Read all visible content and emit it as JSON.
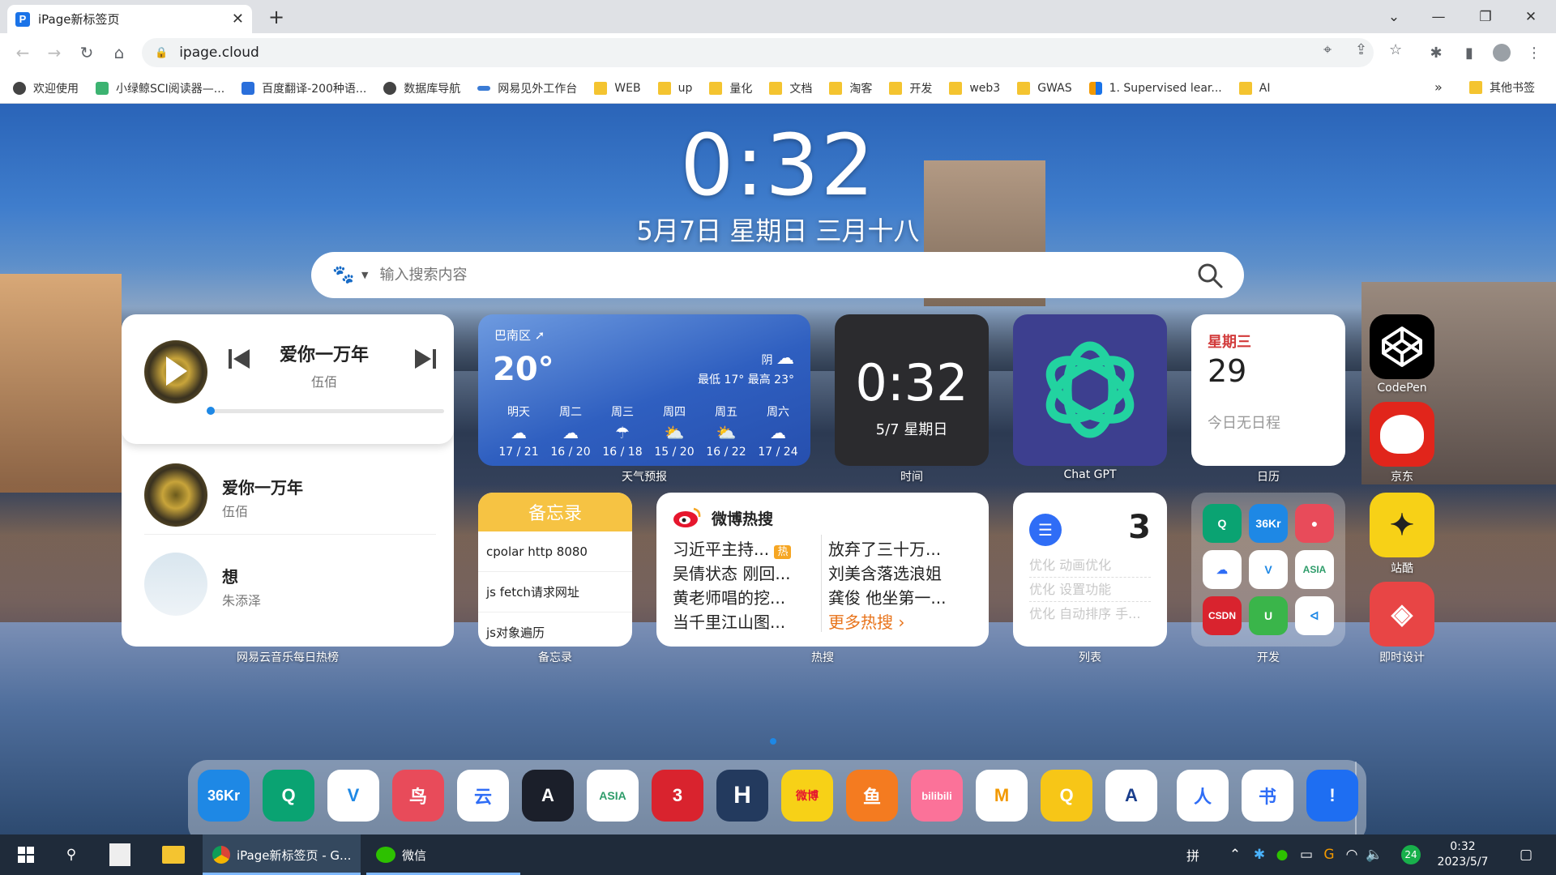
{
  "browser": {
    "tab_title": "iPage新标签页",
    "tab_favicon": "P",
    "url": "ipage.cloud",
    "bookmarks": [
      {
        "label": "欢迎使用",
        "icon": "globe"
      },
      {
        "label": "小绿鲸SCI阅读器—...",
        "icon": "leaf"
      },
      {
        "label": "百度翻译-200种语...",
        "icon": "translate"
      },
      {
        "label": "数据库导航",
        "icon": "globe"
      },
      {
        "label": "网易见外工作台",
        "icon": "wave"
      },
      {
        "label": "WEB",
        "icon": "folder"
      },
      {
        "label": "up",
        "icon": "folder"
      },
      {
        "label": "量化",
        "icon": "folder"
      },
      {
        "label": "文档",
        "icon": "folder"
      },
      {
        "label": "淘客",
        "icon": "folder"
      },
      {
        "label": "开发",
        "icon": "folder"
      },
      {
        "label": "web3",
        "icon": "folder"
      },
      {
        "label": "GWAS",
        "icon": "folder"
      },
      {
        "label": "1. Supervised lear...",
        "icon": "chart"
      },
      {
        "label": "AI",
        "icon": "folder"
      }
    ],
    "bookmarks_more": "»",
    "other_bookmarks": "其他书签"
  },
  "page": {
    "clock": "0:32",
    "date": "5月7日 星期日 三月十八",
    "search_placeholder": "输入搜索内容"
  },
  "music": {
    "now_playing": {
      "title": "爱你一万年",
      "artist": "伍佰",
      "progress": 0.01
    },
    "list": [
      {
        "title": "爱你一万年",
        "artist": "伍佰"
      },
      {
        "title": "想",
        "artist": "朱添泽"
      }
    ],
    "label": "网易云音乐每日热榜"
  },
  "weather": {
    "location": "巴南区",
    "temp": "20°",
    "condition": "阴",
    "range": "最低 17° 最高 23°",
    "forecast": [
      {
        "day": "明天",
        "range": "17 / 21"
      },
      {
        "day": "周二",
        "range": "16 / 20"
      },
      {
        "day": "周三",
        "range": "16 / 18"
      },
      {
        "day": "周四",
        "range": "15 / 20"
      },
      {
        "day": "周五",
        "range": "16 / 22"
      },
      {
        "day": "周六",
        "range": "17 / 24"
      }
    ],
    "label": "天气预报"
  },
  "time_widget": {
    "time": "0:32",
    "date": "5/7 星期日",
    "label": "时间"
  },
  "gpt": {
    "label": "Chat GPT"
  },
  "calendar": {
    "weekday": "星期三",
    "day": "29",
    "note": "今日无日程",
    "label": "日历"
  },
  "memo": {
    "header": "备忘录",
    "items": [
      "cpolar http 8080",
      "js fetch请求网址",
      "js对象遍历"
    ],
    "label": "备忘录"
  },
  "hot": {
    "title": "微博热搜",
    "col1": [
      "习近平主持...",
      "吴倩状态 刚回...",
      "黄老师唱的挖...",
      "当千里江山图..."
    ],
    "col2": [
      "放弃了三十万...",
      "刘美含落选浪姐",
      "龚俊 他坐第一...",
      "更多热搜"
    ],
    "hot_badge": "热",
    "label": "热搜"
  },
  "list_widget": {
    "count": "3",
    "items": [
      "优化 动画优化",
      "优化 设置功能",
      "优化 自动排序 手..."
    ],
    "label": "列表"
  },
  "dev_folder": {
    "label": "开发",
    "apps": [
      "36Kr",
      "CSDN",
      "ASIA"
    ]
  },
  "apps": {
    "codepen": "CodePen",
    "jd": "京东",
    "zhanku": "站酷",
    "jishi": "即时设计"
  },
  "dock": [
    "36Kr",
    "Q",
    "V",
    "鸟",
    "云",
    "A",
    "ASIA",
    "3",
    "H",
    "微博",
    "鱼",
    "bilibili",
    "M",
    "Q",
    "A",
    "人",
    "书",
    "!"
  ],
  "taskbar": {
    "chrome_label": "iPage新标签页 - G...",
    "wechat_label": "微信",
    "clock_time": "0:32",
    "clock_date": "2023/5/7",
    "ime": "拼",
    "badge": "24"
  },
  "colors": {
    "accent": "#1a73e8",
    "memo": "#f6c343",
    "hot_more": "#e8731a",
    "calendar_weekday": "#d23b3b"
  }
}
